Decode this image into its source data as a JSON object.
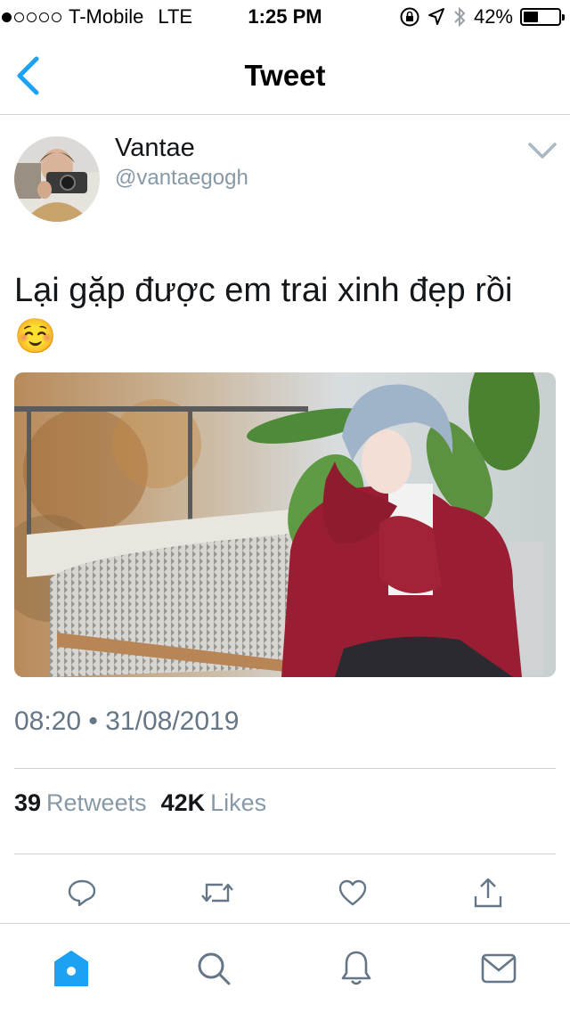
{
  "status_bar": {
    "carrier": "T-Mobile",
    "network": "LTE",
    "time": "1:25 PM",
    "battery": "42%",
    "battery_level": 0.42,
    "signal_bars_filled": 1,
    "signal_bars_total": 5
  },
  "nav": {
    "title": "Tweet",
    "back_icon": "chevron-left-icon"
  },
  "tweet": {
    "display_name": "Vantae",
    "handle": "@vantaegogh",
    "text": "Lại gặp được em trai xinh đẹp rồi ☺️",
    "timestamp": "08:20 • 31/08/2019",
    "retweets_count": "39",
    "retweets_label": "Retweets",
    "likes_count": "42K",
    "likes_label": "Likes"
  },
  "actions": [
    "reply-icon",
    "retweet-icon",
    "like-icon",
    "share-icon"
  ],
  "tabs": [
    "home-icon",
    "search-icon",
    "notifications-icon",
    "messages-icon"
  ],
  "colors": {
    "accent": "#1da1f2",
    "text": "#14171a",
    "secondary": "#8899a6",
    "divider": "#cfd4d9"
  }
}
